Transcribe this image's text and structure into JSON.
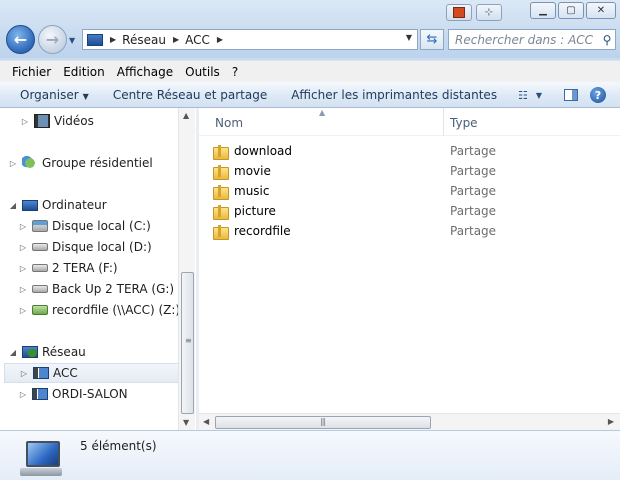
{
  "address": {
    "crumbs": [
      "Réseau",
      "ACC"
    ]
  },
  "search": {
    "placeholder": "Rechercher dans : ACC"
  },
  "menubar": {
    "items": [
      "Fichier",
      "Edition",
      "Affichage",
      "Outils",
      "?"
    ]
  },
  "commandbar": {
    "organize": "Organiser",
    "network_center": "Centre Réseau et partage",
    "remote_printers": "Afficher les imprimantes distantes",
    "help": "?"
  },
  "navpane": {
    "items": [
      {
        "label": "Vidéos",
        "icon": "video-folder-icon"
      },
      {
        "label": "Groupe résidentiel",
        "icon": "homegroup-icon"
      },
      {
        "label": "Ordinateur",
        "icon": "computer-icon"
      },
      {
        "label": "Disque local (C:)",
        "icon": "system-disk-icon"
      },
      {
        "label": "Disque local (D:)",
        "icon": "disk-icon"
      },
      {
        "label": "2 TERA (F:)",
        "icon": "disk-icon"
      },
      {
        "label": "Back Up 2 TERA (G:)",
        "icon": "disk-icon"
      },
      {
        "label": "recordfile (\\\\ACC) (Z:)",
        "icon": "network-drive-icon"
      },
      {
        "label": "Réseau",
        "icon": "network-icon"
      },
      {
        "label": "ACC",
        "icon": "network-computer-icon",
        "selected": true
      },
      {
        "label": "ORDI-SALON",
        "icon": "network-computer-icon"
      }
    ]
  },
  "content": {
    "columns": {
      "name": "Nom",
      "type": "Type"
    },
    "files": [
      {
        "name": "download",
        "type": "Partage"
      },
      {
        "name": "movie",
        "type": "Partage"
      },
      {
        "name": "music",
        "type": "Partage"
      },
      {
        "name": "picture",
        "type": "Partage"
      },
      {
        "name": "recordfile",
        "type": "Partage"
      }
    ]
  },
  "details": {
    "count": "5 élément(s)"
  },
  "colors": {
    "chrome": "#c9dbee",
    "accent": "#1d4f98",
    "folder": "#e8b93a"
  }
}
